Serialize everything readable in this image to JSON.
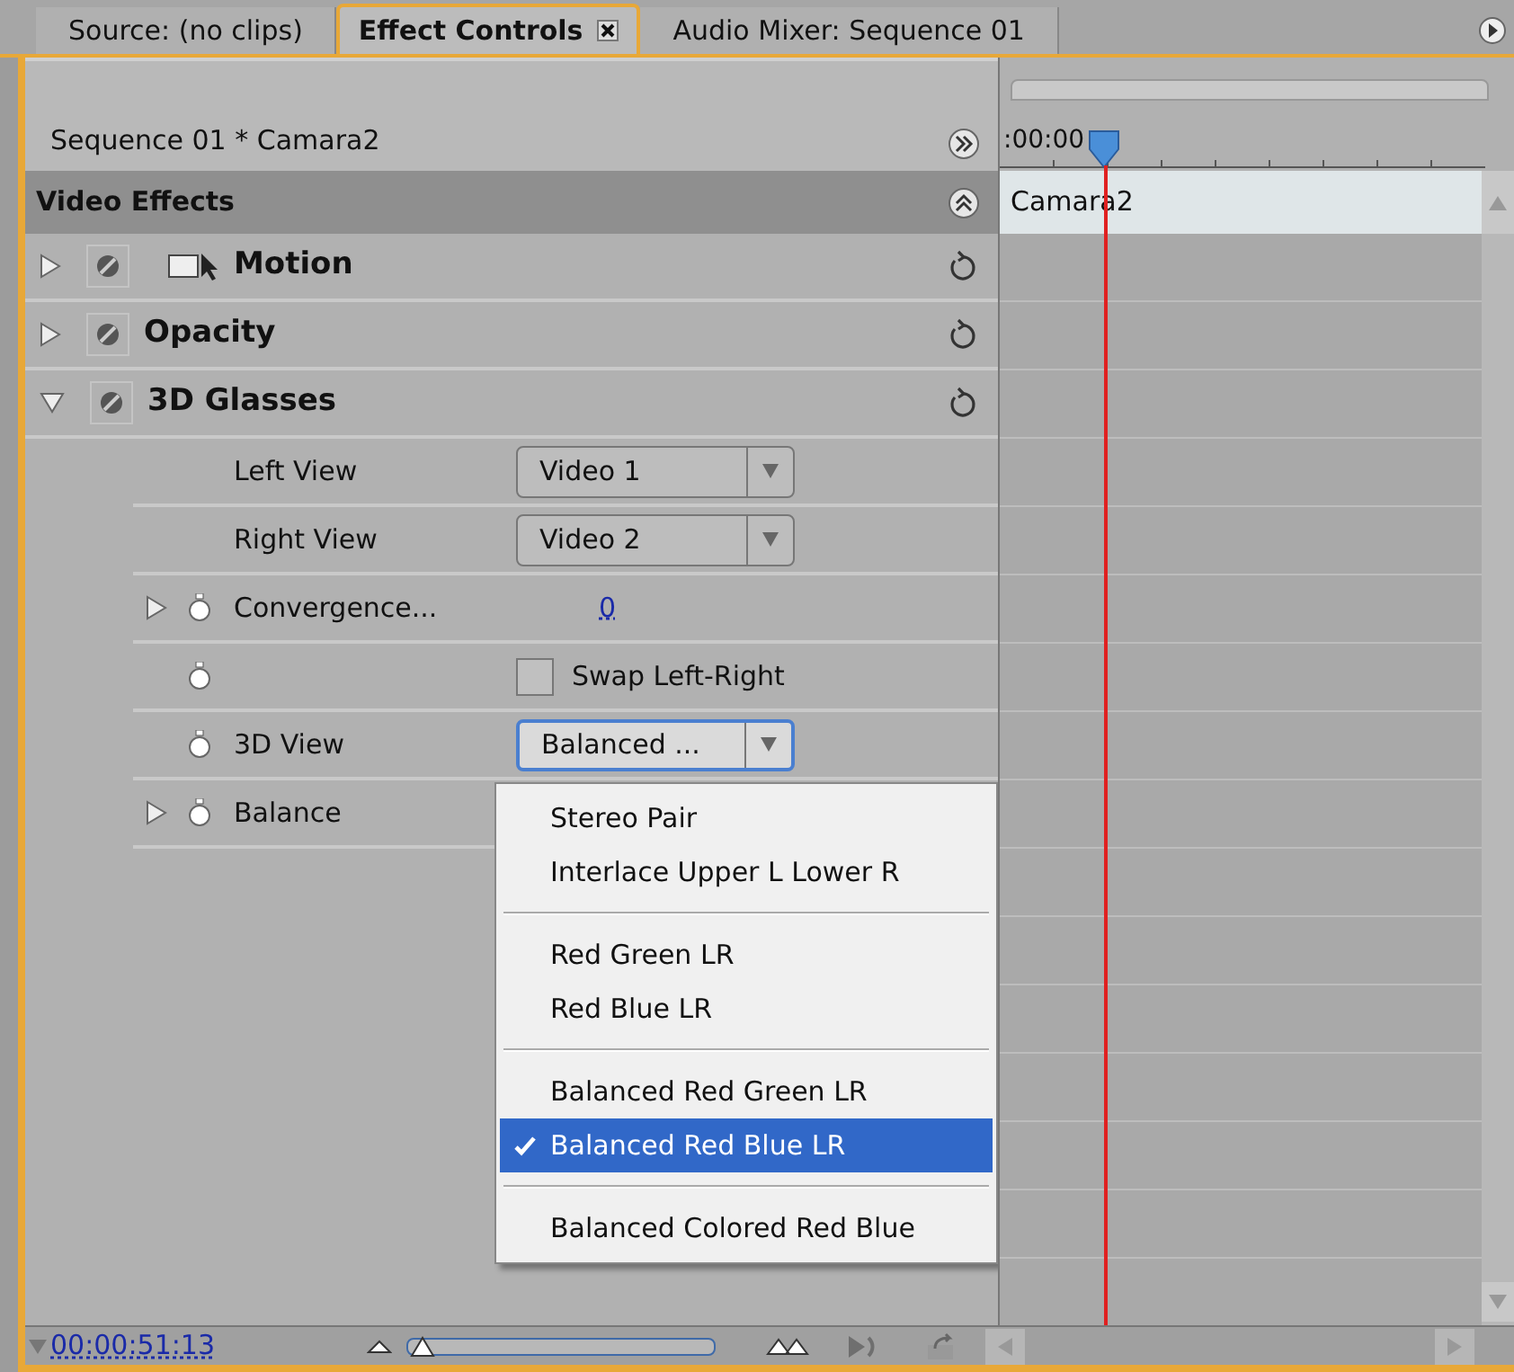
{
  "tabs": [
    {
      "label": "Source: (no clips)",
      "selected": false
    },
    {
      "label": "Effect Controls",
      "selected": true
    },
    {
      "label": "Audio Mixer: Sequence 01",
      "selected": false
    }
  ],
  "clip_title": "Sequence 01 * Camara2",
  "section": "Video Effects",
  "effects": [
    {
      "name": "Motion",
      "kind": "motion",
      "expanded": false
    },
    {
      "name": "Opacity",
      "kind": "plain",
      "expanded": false
    },
    {
      "name": "3D Glasses",
      "kind": "plain",
      "expanded": true,
      "properties": [
        {
          "kind": "dropdown",
          "label": "Left View",
          "value": "Video 1",
          "animatable": false,
          "expandable": false,
          "focused": false
        },
        {
          "kind": "dropdown",
          "label": "Right View",
          "value": "Video 2",
          "animatable": false,
          "expandable": false,
          "focused": false
        },
        {
          "kind": "number",
          "label": "Convergence...",
          "value": "0",
          "animatable": true,
          "expandable": true
        },
        {
          "kind": "checkbox",
          "label": "Swap Left-Right",
          "checked": false,
          "animatable": true,
          "expandable": false
        },
        {
          "kind": "dropdown",
          "label": "3D View",
          "value": "Balanced ...",
          "animatable": true,
          "expandable": false,
          "focused": true
        },
        {
          "kind": "blank",
          "label": "Balance",
          "animatable": true,
          "expandable": true
        }
      ]
    }
  ],
  "menu": [
    {
      "kind": "option",
      "label": "Stereo Pair",
      "selected": false
    },
    {
      "kind": "option",
      "label": "Interlace Upper L Lower R",
      "selected": false
    },
    {
      "kind": "separator"
    },
    {
      "kind": "option",
      "label": "Red Green LR",
      "selected": false
    },
    {
      "kind": "option",
      "label": "Red Blue LR",
      "selected": false
    },
    {
      "kind": "separator"
    },
    {
      "kind": "option",
      "label": "Balanced Red Green LR",
      "selected": false
    },
    {
      "kind": "option",
      "label": "Balanced Red Blue LR",
      "selected": true
    },
    {
      "kind": "separator"
    },
    {
      "kind": "option",
      "label": "Balanced Colored Red Blue",
      "selected": false
    }
  ],
  "timeline": {
    "timecode": ":00:00",
    "clip": "Camara2"
  },
  "footer": {
    "timecode": "00:00:51:13",
    "zoom": {
      "level": 0.02
    }
  }
}
